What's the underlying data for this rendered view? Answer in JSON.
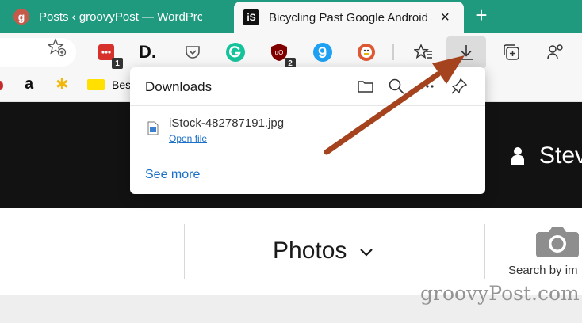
{
  "tabs": [
    {
      "favicon": "g",
      "title": "Posts ‹ groovyPost — WordPress",
      "close": "×"
    },
    {
      "favicon": "iS",
      "title": "Bicycling Past Google Android S",
      "close": "×"
    }
  ],
  "new_tab": "+",
  "toolbar": {
    "extensions": [
      {
        "name": "todoist-icon",
        "badge": "1",
        "color": "#d7312c"
      },
      {
        "name": "dev-icon",
        "label": "D.",
        "color": "#111111"
      },
      {
        "name": "pocket-icon",
        "color": "#555555"
      },
      {
        "name": "grammarly-icon",
        "color": "#15c39a"
      },
      {
        "name": "ublock-icon",
        "badge": "2",
        "color": "#800000"
      },
      {
        "name": "glasp-icon",
        "color": "#1ea1f2"
      },
      {
        "name": "duckduckgo-icon",
        "color": "#de5833"
      }
    ]
  },
  "bookmarks": [
    {
      "name": "amazon-icon",
      "label": "a"
    },
    {
      "name": "walmart-icon",
      "label": "✱"
    },
    {
      "name": "bestbuy-icon",
      "label": "Bes"
    }
  ],
  "downloads": {
    "title": "Downloads",
    "file_name": "iStock-482787191.jpg",
    "open_file": "Open file",
    "see_more": "See more"
  },
  "page": {
    "user_name": "Stev",
    "photos_label": "Photos",
    "search_by_label": "Search by im"
  },
  "watermark": "groovyPost.com",
  "colors": {
    "tabstrip": "#1f9a7f",
    "arrow": "#a5431e",
    "link": "#1a6fc9"
  }
}
